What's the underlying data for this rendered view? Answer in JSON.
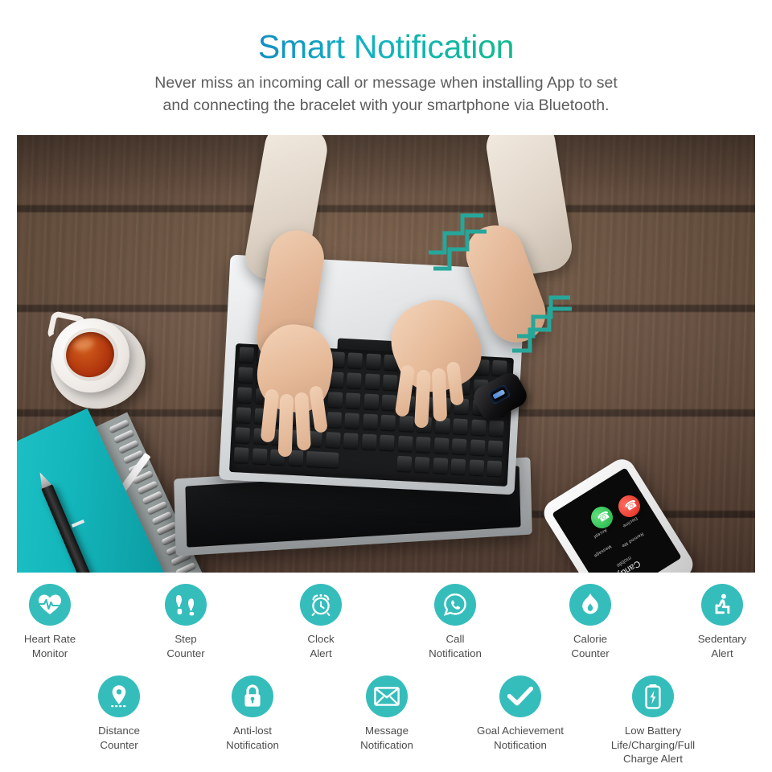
{
  "header": {
    "title": "Smart Notification",
    "subtitle_lines": [
      "Never miss an incoming call or message when installing App to set",
      "and connecting the bracelet with your smartphone via Bluetooth."
    ]
  },
  "colors": {
    "title_gradient_start": "#1a44b8",
    "title_gradient_mid": "#12b3c0",
    "title_gradient_end": "#0cb83c",
    "icon_circle": "#35bdbc",
    "label_text": "#4c4c4c",
    "subtitle_text": "#5d5d5d",
    "wood_base": "#6b4f3d",
    "wood_seam": "#3a2a20",
    "notebook_teal": "#13b6bb",
    "vibration_line": "#27a69a",
    "call_accept": "#22b348",
    "call_decline": "#de2a1c"
  },
  "photo": {
    "scene_description": "Top-down desk photo on dark wood: hands typing on a silver laptop, black fitness bracelet on left wrist vibrating, white smartphone showing incoming call, cup of tea, teal notebook, gray spiral notebook and black pen",
    "phone": {
      "accept_label": "Accept",
      "decline_label": "Decline",
      "remind_label": "Remind Me",
      "message_label": "Message",
      "caller_name": "Candy",
      "caller_type": "mobile"
    },
    "bracelet": {
      "device": "smart fitness bracelet",
      "vibrating": true
    }
  },
  "features": {
    "row1": [
      {
        "icon": "heart-rate-icon",
        "label_lines": [
          "Heart Rate",
          "Monitor"
        ]
      },
      {
        "icon": "footsteps-icon",
        "label_lines": [
          "Step",
          "Counter"
        ]
      },
      {
        "icon": "alarm-clock-icon",
        "label_lines": [
          "Clock",
          "Alert"
        ]
      },
      {
        "icon": "call-bubble-icon",
        "label_lines": [
          "Call",
          "Notification"
        ]
      },
      {
        "icon": "flame-icon",
        "label_lines": [
          "Calorie",
          "Counter"
        ]
      },
      {
        "icon": "sedentary-person-icon",
        "label_lines": [
          "Sedentary",
          "Alert"
        ]
      }
    ],
    "row2": [
      {
        "icon": "map-pin-icon",
        "label_lines": [
          "Distance",
          "Counter"
        ]
      },
      {
        "icon": "padlock-icon",
        "label_lines": [
          "Anti-lost",
          "Notification"
        ]
      },
      {
        "icon": "envelope-icon",
        "label_lines": [
          "Message",
          "Notification"
        ]
      },
      {
        "icon": "checkmark-icon",
        "label_lines": [
          "Goal Achievement",
          "Notification"
        ]
      },
      {
        "icon": "battery-icon",
        "label_lines": [
          "Low Battery",
          "Life/Charging/Full",
          "Charge Alert"
        ]
      }
    ]
  }
}
